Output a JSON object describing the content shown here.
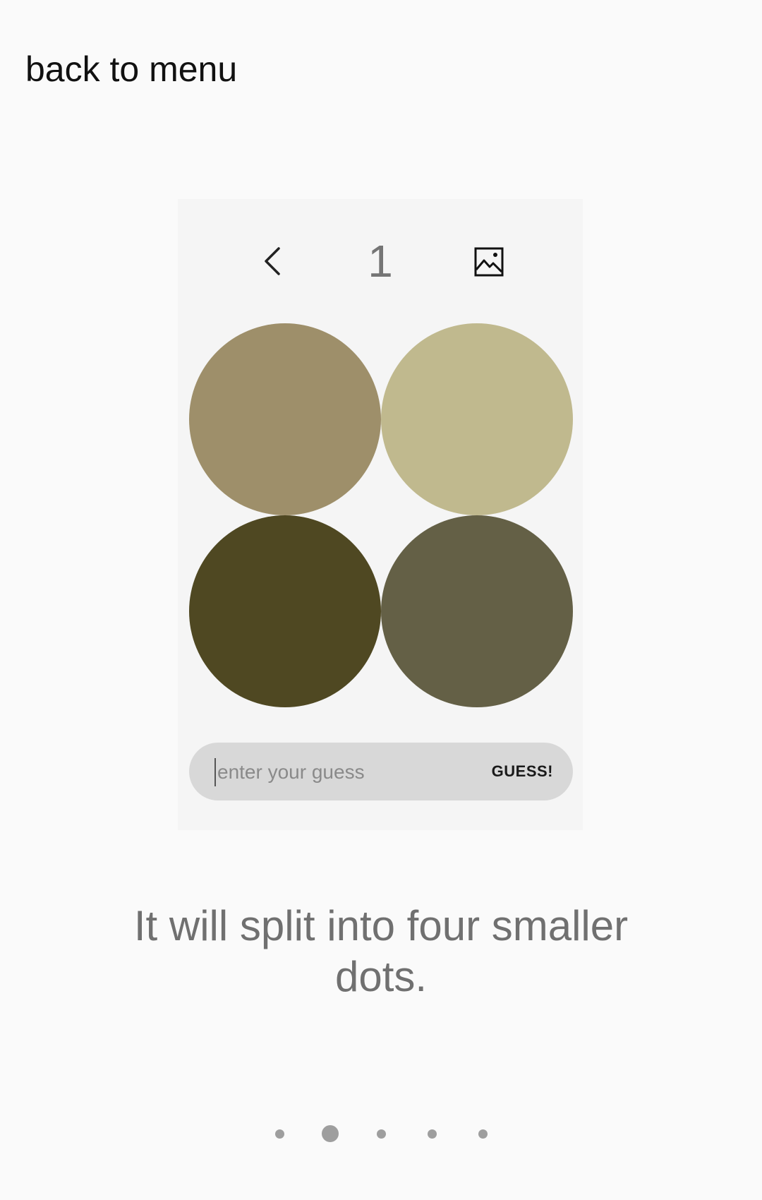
{
  "nav": {
    "back_label": "back to menu"
  },
  "level": {
    "number": "1"
  },
  "dots": [
    {
      "color": "#9e8f6a"
    },
    {
      "color": "#c0b98e"
    },
    {
      "color": "#4f4822"
    },
    {
      "color": "#646046"
    }
  ],
  "guess": {
    "placeholder": "enter your guess",
    "value": "",
    "button_label": "GUESS!"
  },
  "hint": {
    "text": "It will split into four smaller dots."
  },
  "pager": {
    "count": 5,
    "active_index": 1
  },
  "icons": {
    "back": "chevron-left-icon",
    "image": "image-icon"
  }
}
